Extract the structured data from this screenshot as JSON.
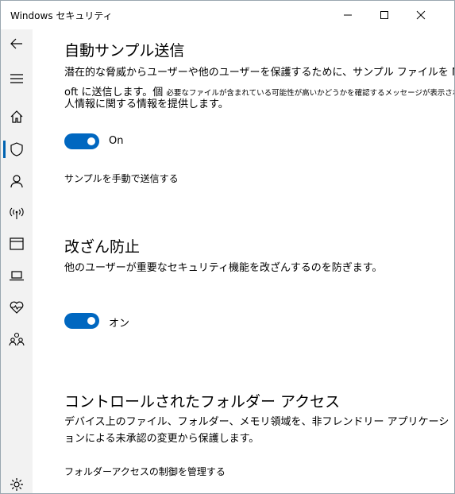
{
  "window": {
    "title": "Windows セキュリティ"
  },
  "sections": {
    "sample": {
      "heading": "自動サンプル送信",
      "line1": "潜在的な脅威からユーザーや他のユーザーを保護するために、サンプル ファイルを Micros",
      "line2_prefix": "oft に送信します。個",
      "line2_overlay": "必要なファイルが含まれている可能性が高いかどうかを確認するメッセージが表示されます",
      "line3": "人情報に関する情報を提供します。",
      "toggle_label": "On",
      "toggle_on": true,
      "link": "サンプルを手動で送信する"
    },
    "tamper": {
      "heading": "改ざん防止",
      "description": "他のユーザーが重要なセキュリティ機能を改ざんするのを防ぎます。",
      "toggle_label": "オン",
      "toggle_on": true
    },
    "folder": {
      "heading": "コントロールされたフォルダー アクセス",
      "line1": "デバイス上のファイル、フォルダー、メモリ領域を、非フレンドリー アプリケーシ",
      "line2": "ョンによる未承認の変更から保護します。",
      "link": "フォルダーアクセスの制御を管理する"
    }
  },
  "sidebar": {
    "icons": [
      "back-arrow-icon",
      "hamburger-menu-icon",
      "home-icon",
      "shield-icon",
      "person-icon",
      "wireless-antenna-icon",
      "browser-window-icon",
      "laptop-icon",
      "heart-pulse-icon",
      "family-icon",
      "gear-icon"
    ],
    "active": "shield-icon"
  },
  "colors": {
    "accent": "#0067c0",
    "sidebar_bg": "#f2f2f2"
  }
}
